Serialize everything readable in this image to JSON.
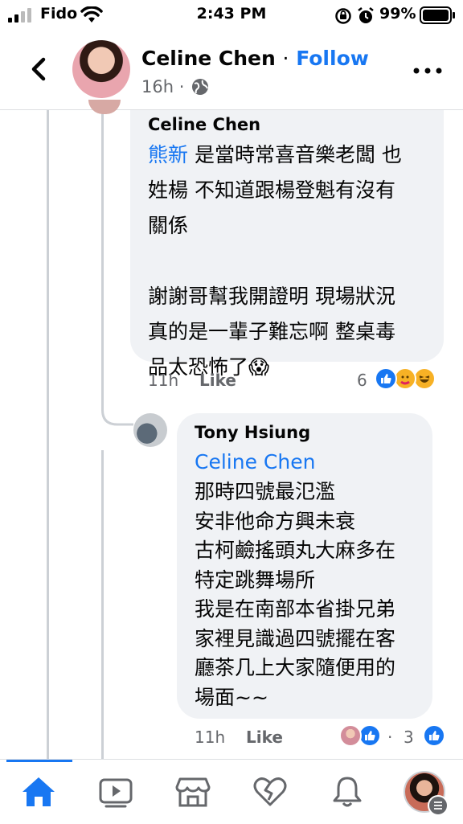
{
  "status_bar": {
    "carrier": "Fido",
    "time": "2:43 PM",
    "battery_percent": "99%"
  },
  "header": {
    "author_name": "Celine Chen",
    "separator": "·",
    "follow_label": "Follow",
    "post_age": "16h ·"
  },
  "comments": [
    {
      "author": "Celine Chen",
      "mention": "熊新",
      "text_after_mention": " 是當時常喜音樂老闆 也\n姓楊 不知道跟楊登魁有沒有\n關係\n\n謝謝哥幫我開證明 現場狀況\n真的是一輩子難忘啊 整桌毒\n品太恐怖了😱",
      "time": "11h",
      "like_label": "Like",
      "reaction_count": "6"
    },
    {
      "author": "Tony Hsiung",
      "mention": "Celine Chen",
      "text": "那時四號最氾濫\n安非他命方興未衰\n古柯鹼搖頭丸大麻多在\n特定跳舞場所\n我是在南部本省掛兄弟\n家裡見識過四號擺在客\n廳茶几上大家隨便用的\n場面~~",
      "time": "11h",
      "like_label": "Like",
      "separator": "·",
      "reaction_count": "3"
    }
  ],
  "tabs": [
    "home",
    "video",
    "marketplace",
    "dating",
    "notifications",
    "profile"
  ],
  "colors": {
    "accent": "#1877f2",
    "bubble": "#f0f2f5",
    "secondary_text": "#65676b"
  }
}
